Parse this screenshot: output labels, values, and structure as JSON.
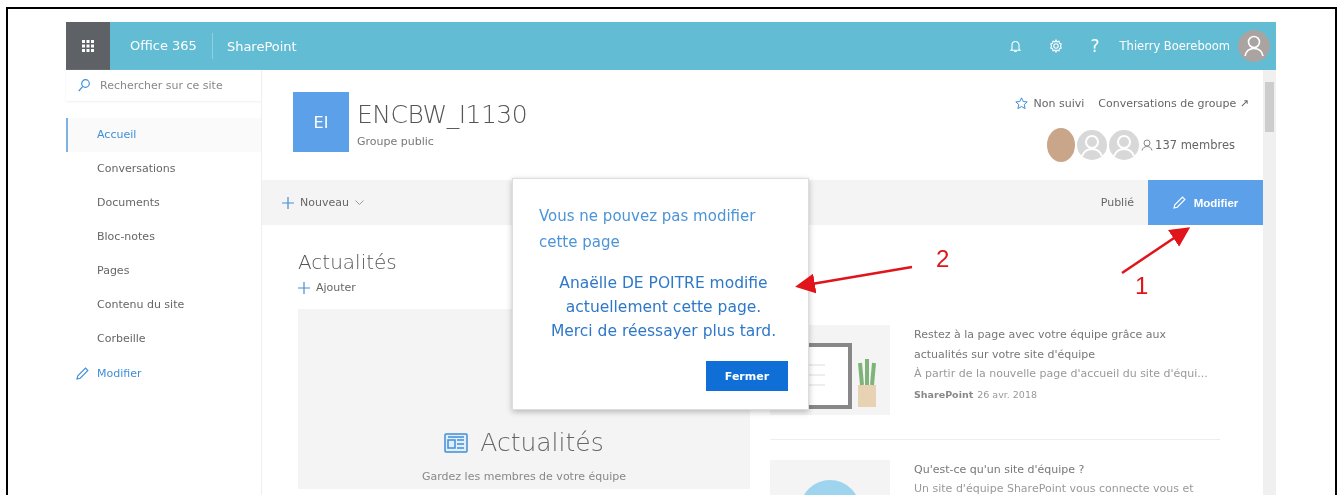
{
  "topbar": {
    "app_name": "Office 365",
    "product": "SharePoint",
    "help_label": "?",
    "user_name": "Thierry Boereboom"
  },
  "sidebar": {
    "search_placeholder": "Rechercher sur ce site",
    "items": [
      {
        "label": "Accueil",
        "selected": true
      },
      {
        "label": "Conversations",
        "selected": false
      },
      {
        "label": "Documents",
        "selected": false
      },
      {
        "label": "Bloc-notes",
        "selected": false
      },
      {
        "label": "Pages",
        "selected": false
      },
      {
        "label": "Contenu du site",
        "selected": false
      },
      {
        "label": "Corbeille",
        "selected": false
      }
    ],
    "edit_link": "Modifier"
  },
  "site": {
    "logo_text": "EI",
    "title": "ENCBW_I1130",
    "privacy": "Groupe public",
    "follow_label": "Non suivi",
    "conversations_link": "Conversations de groupe ↗",
    "members": "137 membres"
  },
  "command_bar": {
    "new_label": "Nouveau",
    "status": "Publié",
    "edit_button": "Modifier"
  },
  "news": {
    "heading": "Actualités",
    "add_label": "Ajouter",
    "placeholder_title": "Actualités",
    "placeholder_text": "Gardez les membres de votre équipe"
  },
  "news_items": [
    {
      "kind": "plant",
      "title": "Restez à la page avec votre équipe grâce aux actualités sur votre site d'équipe",
      "description": "À partir de la nouvelle page d'accueil du site d'équi...",
      "source": "SharePoint",
      "date": "26 avr. 2018"
    },
    {
      "kind": "circle",
      "title": "Qu'est-ce qu'un site d'équipe ?",
      "description": "Un site d'équipe SharePoint vous connecte vous et"
    }
  ],
  "dialog": {
    "title": "Vous ne pouvez pas modifier cette page",
    "message_lines": [
      "Anaëlle DE POITRE modifie",
      "actuellement cette page.",
      "Merci de réessayer plus tard."
    ],
    "button": "Fermer"
  },
  "annotations": [
    {
      "label": "1"
    },
    {
      "label": "2"
    }
  ]
}
